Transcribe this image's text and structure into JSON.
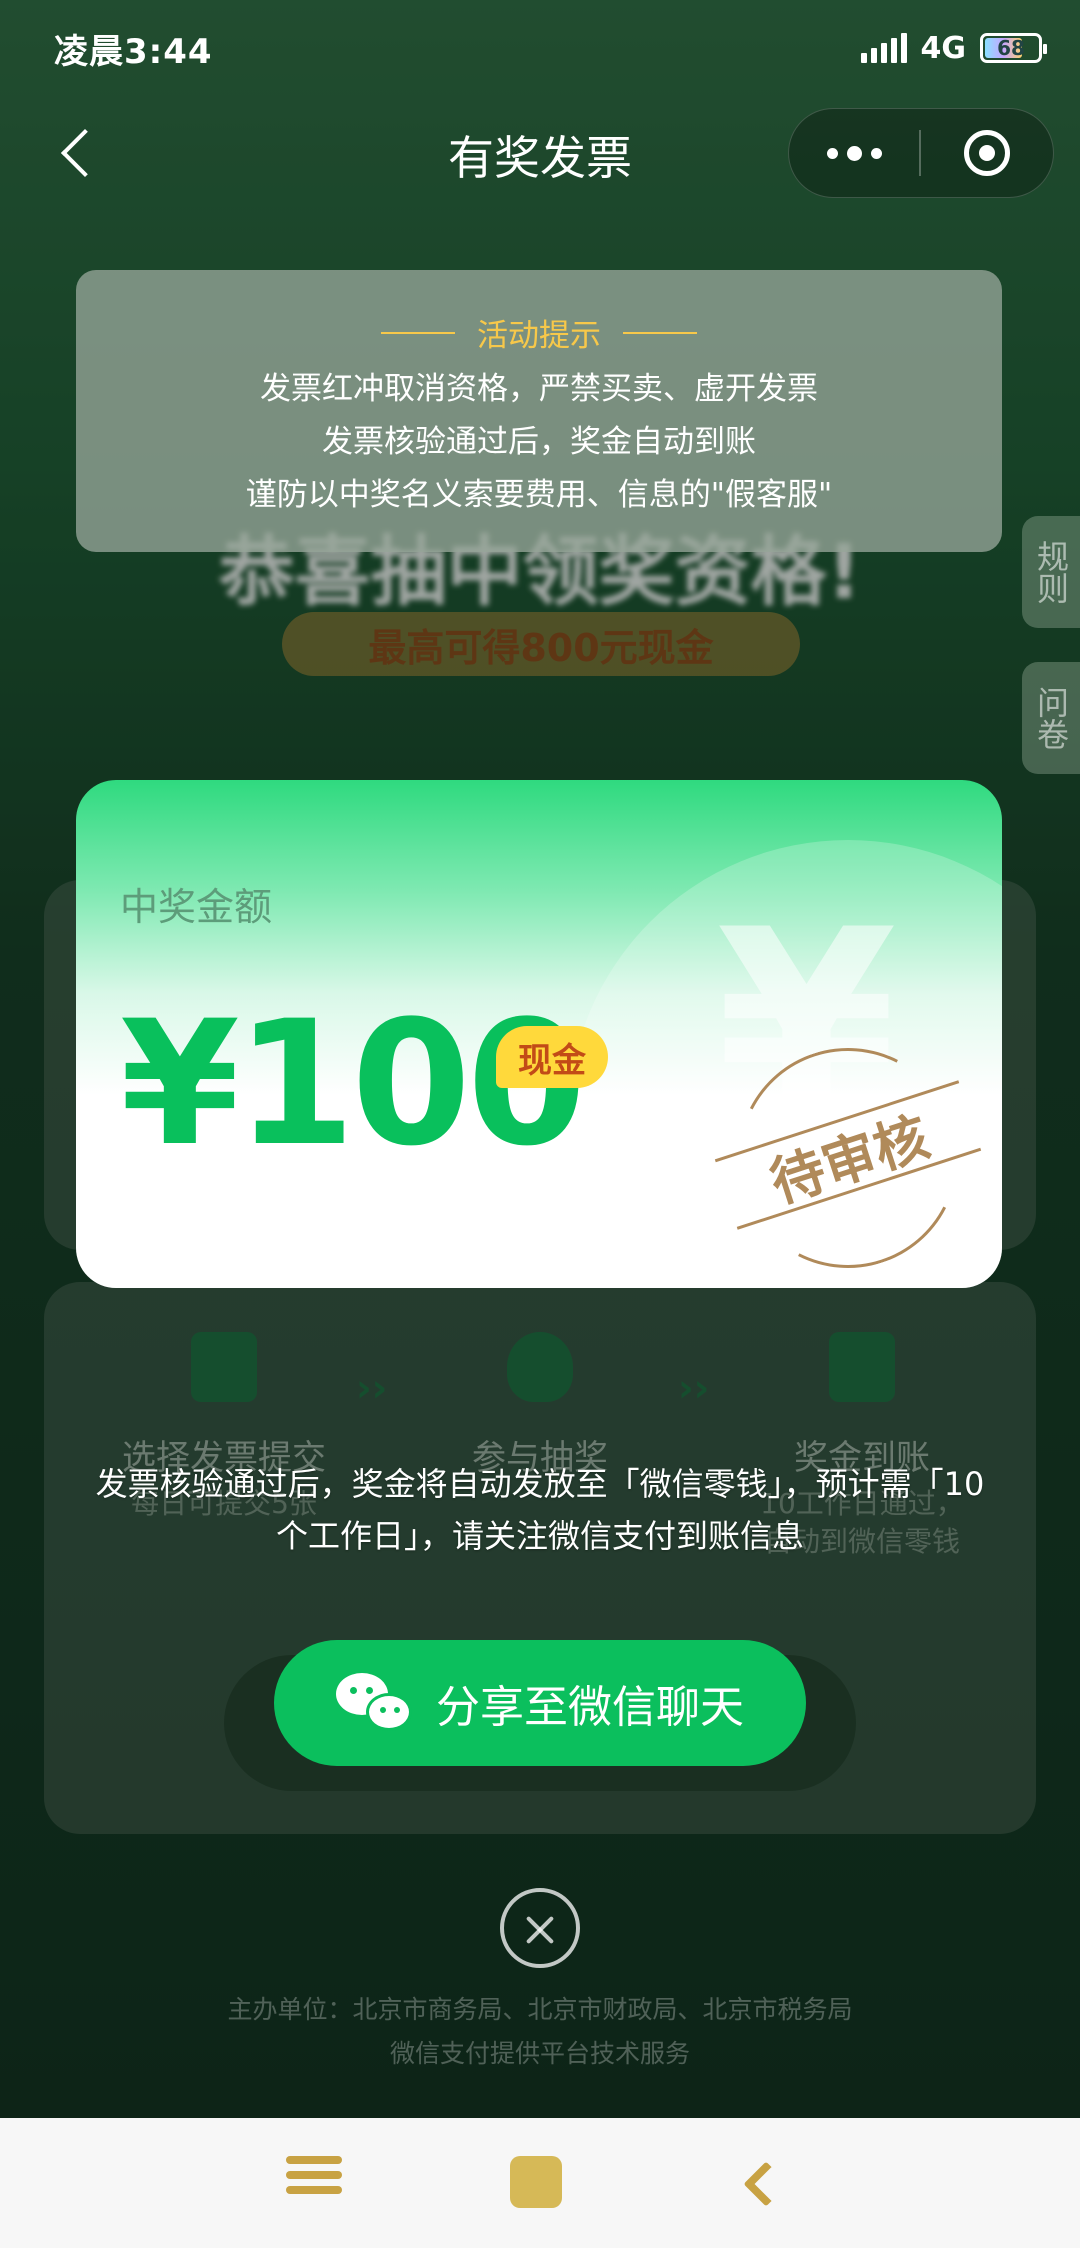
{
  "status_bar": {
    "time": "凌晨3:44",
    "network": "4G",
    "battery": "68"
  },
  "nav": {
    "title": "有奖发票"
  },
  "side_tabs": {
    "rules": "规则",
    "survey": "问卷"
  },
  "background": {
    "headline": "恭喜抽中领奖资格!",
    "subtitle": "最高可得800元现金",
    "steps": [
      {
        "title": "选择发票提交",
        "sub": "每日可提交5张"
      },
      {
        "title": "参与抽奖",
        "sub": ""
      },
      {
        "title": "奖金到账",
        "sub": "10工作日通过，自动到微信零钱"
      }
    ]
  },
  "notice": {
    "title": "活动提示",
    "lines": [
      "发票红冲取消资格，严禁买卖、虚开发票",
      "发票核验通过后，奖金自动到账",
      "谨防以中奖名义索要费用、信息的\"假客服\""
    ]
  },
  "prize": {
    "label": "中奖金额",
    "amount": "¥100",
    "badge": "现金",
    "stamp": "待审核",
    "watermark": "¥"
  },
  "toast": {
    "line1": "发票核验通过后，奖金将自动发放至「微信零钱」，预计需「10",
    "line2": "个工作日」，请关注微信支付到账信息"
  },
  "share_button": {
    "label": "分享至微信聊天"
  },
  "footer": {
    "line1": "主办单位：北京市商务局、北京市财政局、北京市税务局",
    "line2": "微信支付提供平台技术服务"
  },
  "colors": {
    "accent": "#0bbf5d",
    "notice_title": "#f7c84a",
    "badge": "#ffd93b",
    "stamp": "#b08a5a"
  }
}
